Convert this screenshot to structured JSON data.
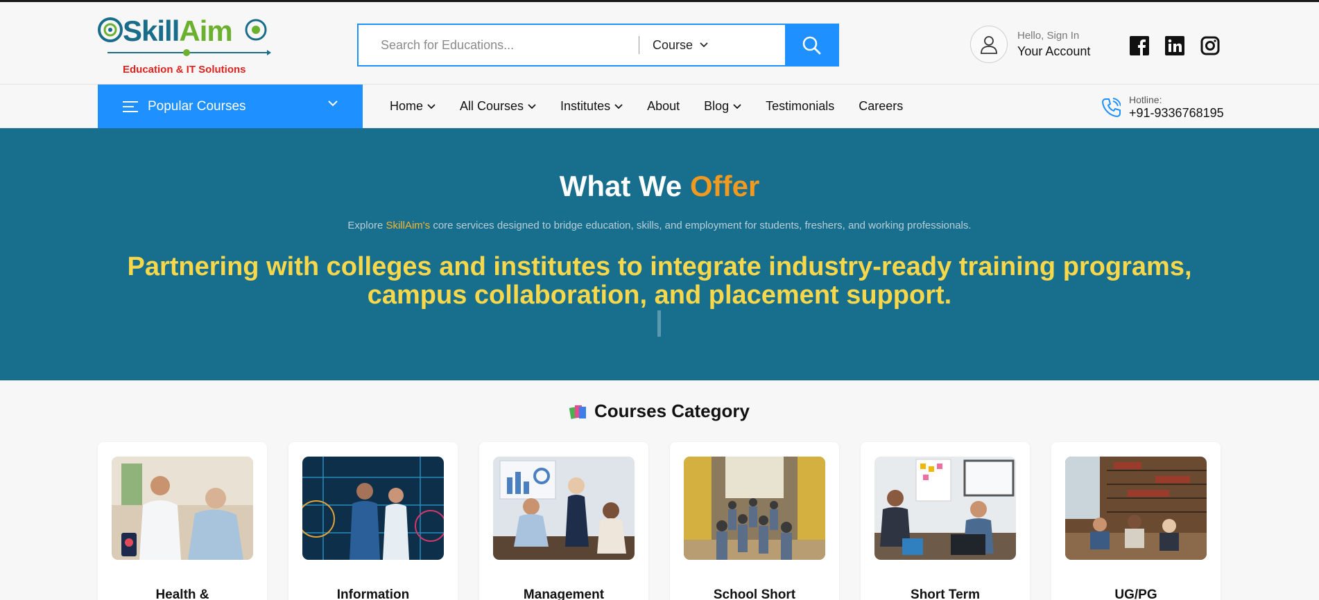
{
  "brand": {
    "name_part1": "Skill",
    "name_part2": "Aim",
    "tagline": "Education & IT Solutions",
    "primary_color": "#1a6d8a",
    "secondary_color": "#6bb02e",
    "tagline_color": "#e0211d"
  },
  "search": {
    "placeholder": "Search for Educations...",
    "category": "Course",
    "button_icon": "search-icon",
    "accent": "#1e90ff"
  },
  "account": {
    "greeting": "Hello, Sign In",
    "label": "Your Account",
    "icon": "user-icon"
  },
  "socials": [
    "facebook-icon",
    "linkedin-icon",
    "instagram-icon"
  ],
  "nav": {
    "popular_label": "Popular Courses",
    "items": [
      {
        "label": "Home",
        "dropdown": true
      },
      {
        "label": "All Courses",
        "dropdown": true
      },
      {
        "label": "Institutes",
        "dropdown": true
      },
      {
        "label": "About",
        "dropdown": false
      },
      {
        "label": "Blog",
        "dropdown": true
      },
      {
        "label": "Testimonials",
        "dropdown": false
      },
      {
        "label": "Careers",
        "dropdown": false
      }
    ],
    "hotline_label": "Hotline:",
    "hotline_number": "+91-9336768195"
  },
  "hero": {
    "title_part1": "What We ",
    "title_part2": "Offer",
    "subtitle_pre": "Explore ",
    "subtitle_brand": "SkillAim's",
    "subtitle_post": " core services designed to bridge education, skills, and employment for students, freshers, and working professionals.",
    "tagline": "Partnering with colleges and institutes to integrate industry-ready training programs, campus collaboration, and placement support.",
    "background": "#176e8d",
    "tagline_color": "#f8d84a"
  },
  "courses": {
    "title": "Courses Category",
    "items": [
      {
        "label": "Health &",
        "image": "healthcare-photo"
      },
      {
        "label": "Information",
        "image": "it-datacenter-photo"
      },
      {
        "label": "Management",
        "image": "business-meeting-photo"
      },
      {
        "label": "School Short",
        "image": "school-hallway-photo"
      },
      {
        "label": "Short Term",
        "image": "workshop-photo"
      },
      {
        "label": "UG/PG",
        "image": "library-photo"
      }
    ]
  }
}
